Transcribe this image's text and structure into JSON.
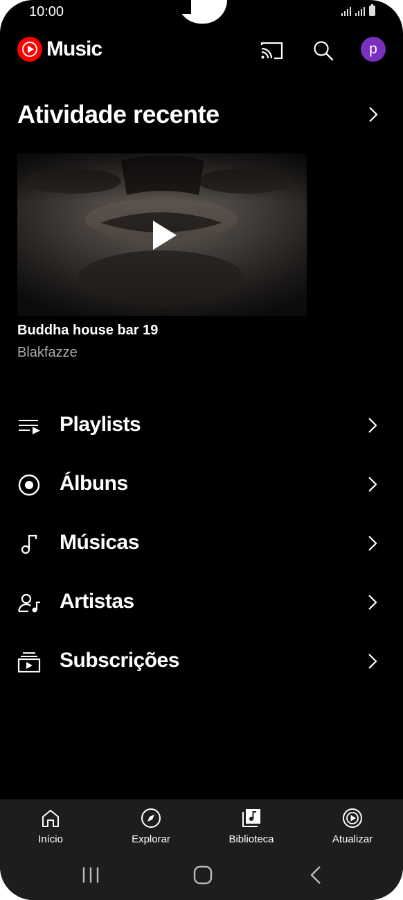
{
  "status": {
    "time": "10:00"
  },
  "header": {
    "app_name": "Music",
    "avatar_letter": "p"
  },
  "recent": {
    "title": "Atividade recente",
    "item": {
      "title": "Buddha house bar 19",
      "artist": "Blakfazze"
    }
  },
  "library": [
    {
      "label": "Playlists",
      "icon": "playlist-icon"
    },
    {
      "label": "Álbuns",
      "icon": "album-icon"
    },
    {
      "label": "Músicas",
      "icon": "music-note-icon"
    },
    {
      "label": "Artistas",
      "icon": "artist-icon"
    },
    {
      "label": "Subscrições",
      "icon": "subscriptions-icon"
    }
  ],
  "bottom_nav": [
    {
      "label": "Início",
      "icon": "home-icon"
    },
    {
      "label": "Explorar",
      "icon": "compass-icon"
    },
    {
      "label": "Biblioteca",
      "icon": "library-icon",
      "active": true
    },
    {
      "label": "Atualizar",
      "icon": "upgrade-icon"
    }
  ],
  "colors": {
    "brand": "#ff0000",
    "avatar": "#7b2fbe",
    "background": "#000000",
    "nav_background": "#1d1d1d"
  }
}
